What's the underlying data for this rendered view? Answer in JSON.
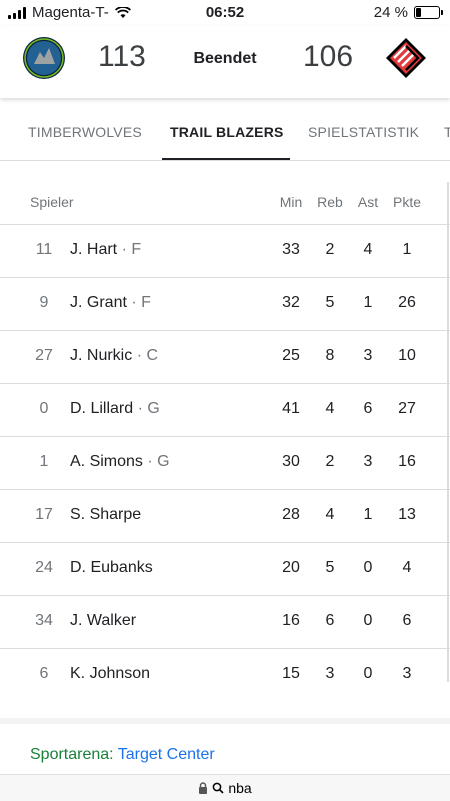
{
  "status_bar": {
    "carrier": "Magenta-T-",
    "time": "06:52",
    "battery": "24 %",
    "battery_level": 0.24
  },
  "scoreboard": {
    "home_team_logo": "timberwolves-logo",
    "home_score": "113",
    "status": "Beendet",
    "away_score": "106",
    "away_team_logo": "trail-blazers-logo"
  },
  "tabs": [
    {
      "label": "TIMBERWOLVES",
      "active": false
    },
    {
      "label": "TRAIL BLAZERS",
      "active": true
    },
    {
      "label": "SPIELSTATISTIK",
      "active": false
    },
    {
      "label": "T",
      "active": false
    }
  ],
  "table": {
    "headers": {
      "player": "Spieler",
      "min": "Min",
      "reb": "Reb",
      "ast": "Ast",
      "pts": "Pkte"
    },
    "rows": [
      {
        "number": "11",
        "name": "J. Hart",
        "position": "· F",
        "min": "33",
        "reb": "2",
        "ast": "4",
        "pts": "1"
      },
      {
        "number": "9",
        "name": "J. Grant",
        "position": "· F",
        "min": "32",
        "reb": "5",
        "ast": "1",
        "pts": "26"
      },
      {
        "number": "27",
        "name": "J. Nurkic",
        "position": "· C",
        "min": "25",
        "reb": "8",
        "ast": "3",
        "pts": "10"
      },
      {
        "number": "0",
        "name": "D. Lillard",
        "position": "· G",
        "min": "41",
        "reb": "4",
        "ast": "6",
        "pts": "27"
      },
      {
        "number": "1",
        "name": "A. Simons",
        "position": "· G",
        "min": "30",
        "reb": "2",
        "ast": "3",
        "pts": "16"
      },
      {
        "number": "17",
        "name": "S. Sharpe",
        "position": "",
        "min": "28",
        "reb": "4",
        "ast": "1",
        "pts": "13"
      },
      {
        "number": "24",
        "name": "D. Eubanks",
        "position": "",
        "min": "20",
        "reb": "5",
        "ast": "0",
        "pts": "4"
      },
      {
        "number": "34",
        "name": "J. Walker",
        "position": "",
        "min": "16",
        "reb": "6",
        "ast": "0",
        "pts": "6"
      },
      {
        "number": "6",
        "name": "K. Johnson",
        "position": "",
        "min": "15",
        "reb": "3",
        "ast": "0",
        "pts": "3"
      }
    ]
  },
  "venue": {
    "label": "Sportarena:",
    "name": "Target Center"
  },
  "url_bar": {
    "text": "nba",
    "icons": [
      "lock-icon",
      "search-icon"
    ]
  },
  "colors": {
    "venue_label": "#188038",
    "link": "#1a73e8",
    "trail_blazers_red": "#e03a3e",
    "timberwolves_navy": "#0c2340"
  }
}
